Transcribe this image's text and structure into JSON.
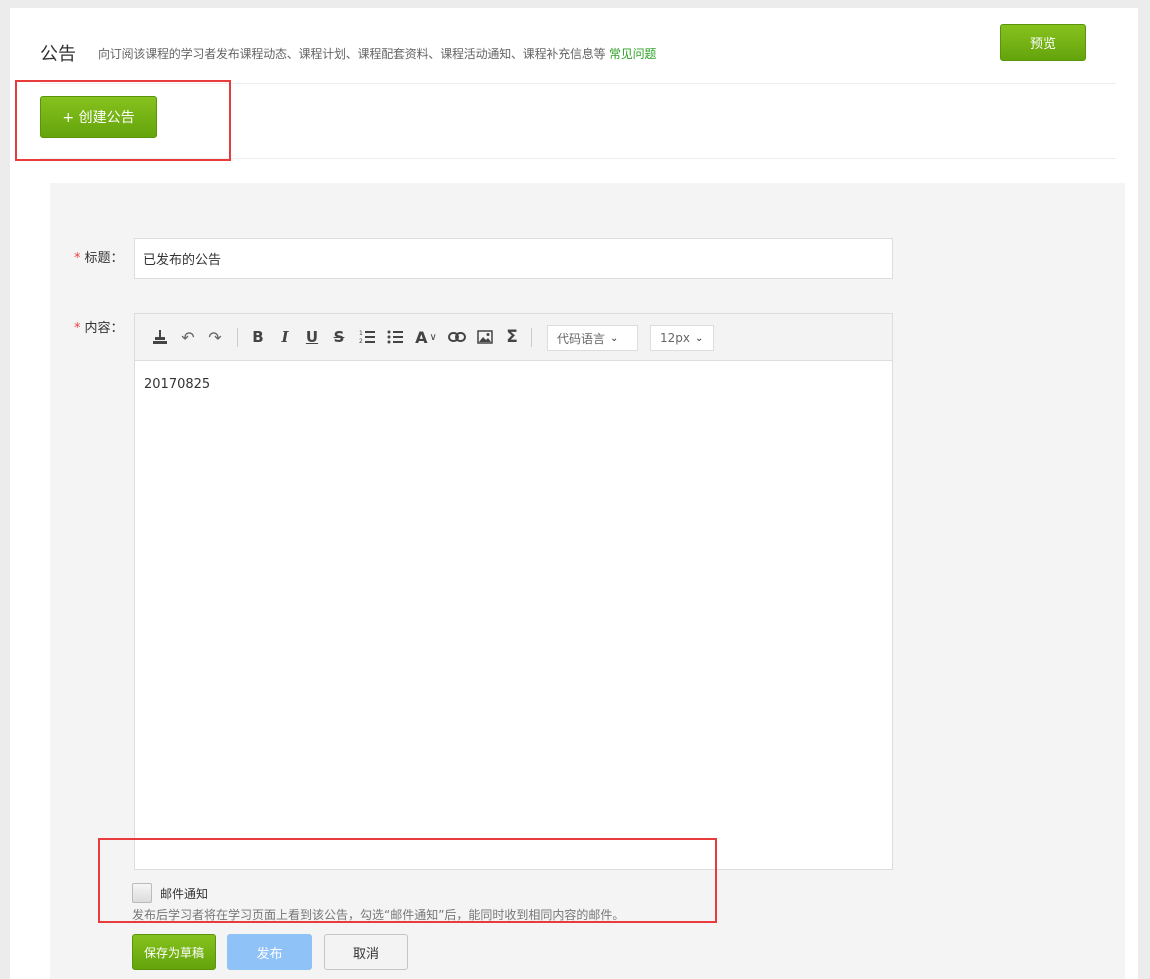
{
  "header": {
    "title": "公告",
    "description": "向订阅该课程的学习者发布课程动态、课程计划、课程配套资料、课程活动通知、课程补充信息等",
    "faq_link": "常见问题",
    "preview_button": "预览"
  },
  "create_button": "+ 创建公告",
  "form": {
    "required_mark": "*",
    "title_label": "标题：",
    "title_value": "已发布的公告",
    "content_label": "内容：",
    "content_value": "20170825",
    "toolbar": {
      "icons": [
        "format-painter-icon",
        "undo-icon",
        "redo-icon",
        "bold-icon",
        "italic-icon",
        "underline-icon",
        "strikethrough-icon",
        "ordered-list-icon",
        "unordered-list-icon",
        "font-color-icon",
        "link-icon",
        "image-icon",
        "formula-icon"
      ],
      "code_language": "代码语言",
      "font_size": "12px"
    },
    "email_notify_label": "邮件通知",
    "email_notify_checked": false,
    "hint": "发布后学习者将在学习页面上看到该公告，勾选“邮件通知”后，能同时收到相同内容的邮件。",
    "save_draft_button": "保存为草稿",
    "publish_button": "发布",
    "cancel_button": "取消"
  },
  "colors": {
    "brand_green": "#6cad10",
    "link_green": "#2ea026",
    "publish_blue": "#8fc2f6",
    "highlight_red": "#e83b3b",
    "required_red": "#e44"
  }
}
